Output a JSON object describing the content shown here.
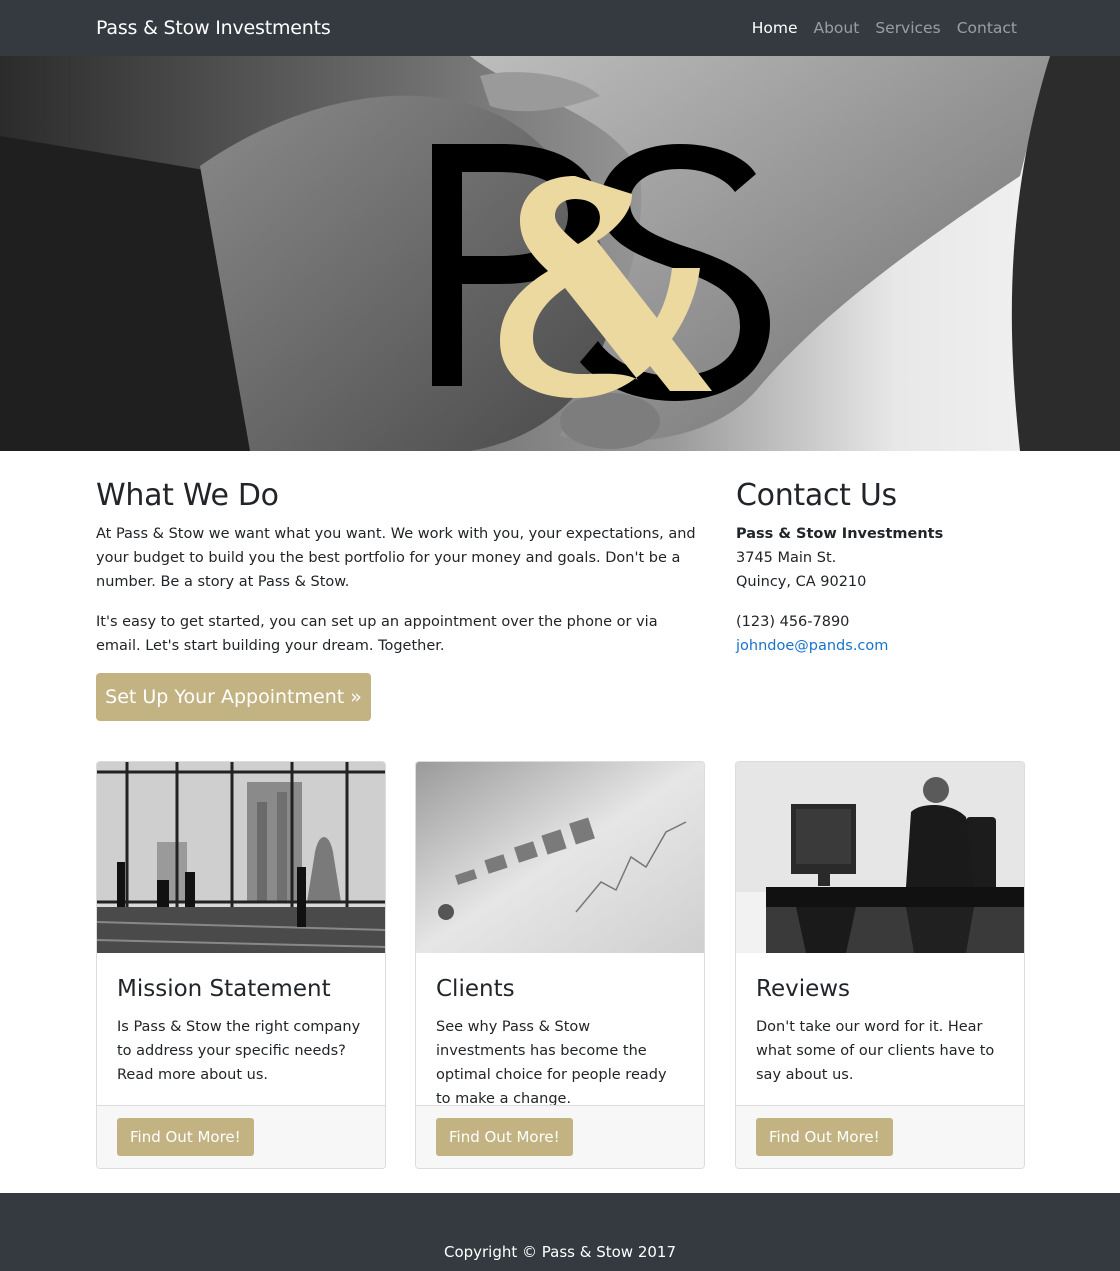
{
  "navbar": {
    "brand": "Pass & Stow Investments",
    "links": [
      "Home",
      "About",
      "Services",
      "Contact"
    ],
    "active": "Home"
  },
  "hero": {
    "logo_letters": [
      "P",
      "&",
      "S"
    ],
    "accent_color": "#ecd9a0"
  },
  "what_we_do": {
    "heading": "What We Do",
    "paragraphs": [
      "At Pass & Stow we want what you want. We work with you, your expectations, and your budget to build you the best portfolio for your money and goals. Don't be a number. Be a story at Pass & Stow.",
      "It's easy to get started, you can set up an appointment over the phone or via email. Let's start building your dream. Together."
    ],
    "button": "Set Up Your Appointment »"
  },
  "contact": {
    "heading": "Contact Us",
    "company": "Pass & Stow Investments",
    "street": "3745 Main St.",
    "city": "Quincy, CA 90210",
    "phone": "(123) 456-7890",
    "email": "johndoe@pands.com"
  },
  "cards": [
    {
      "title": "Mission Statement",
      "text": "Is Pass & Stow the right company to address your specific needs? Read more about us.",
      "button": "Find Out More!",
      "image": "office-skyline-photo"
    },
    {
      "title": "Clients",
      "text": "See why Pass & Stow investments has become the optimal choice for people ready to make a change.",
      "button": "Find Out More!",
      "image": "financial-chart-photo"
    },
    {
      "title": "Reviews",
      "text": "Don't take our word for it. Hear what some of our clients have to say about us.",
      "button": "Find Out More!",
      "image": "man-at-computer-photo"
    }
  ],
  "footer": {
    "copyright": "Copyright © Pass & Stow 2017"
  },
  "colors": {
    "navbar_bg": "#343a40",
    "button_gold": "#c3b383",
    "link_blue": "#1a73c9"
  }
}
